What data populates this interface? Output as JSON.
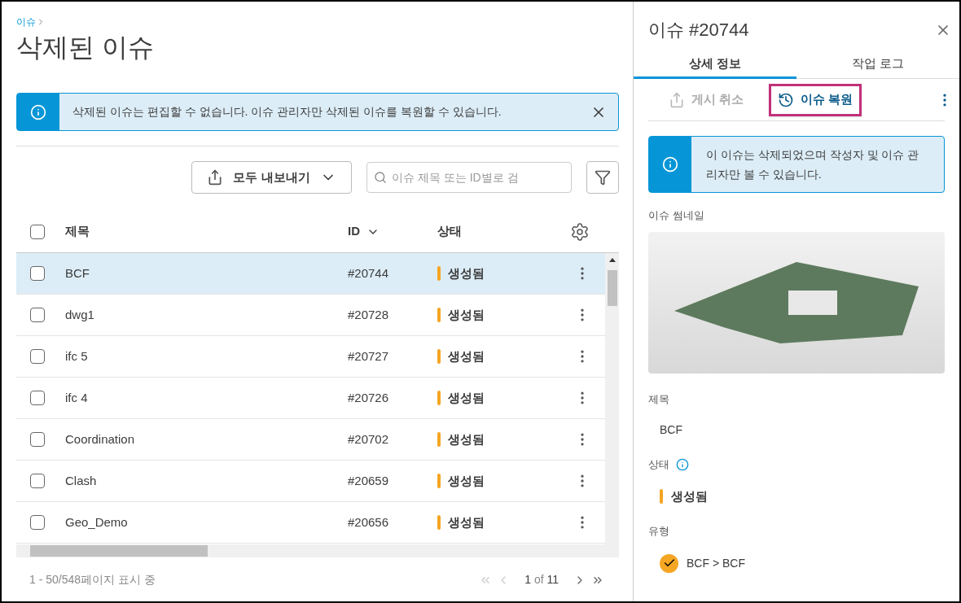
{
  "breadcrumb": "이슈",
  "page_title": "삭제된 이슈",
  "banner": {
    "message": "삭제된 이슈는 편집할 수 없습니다. 이슈 관리자만 삭제된 이슈를 복원할 수 있습니다."
  },
  "toolbar": {
    "export_label": "모두 내보내기",
    "search": {
      "placeholder": "이슈 제목 또는 ID별로 검"
    }
  },
  "table": {
    "columns": [
      {
        "label": "제목",
        "sorted": false
      },
      {
        "label": "ID",
        "sorted": true
      },
      {
        "label": "상태",
        "sorted": false
      }
    ],
    "header_checked": false,
    "rows": [
      {
        "title": "BCF",
        "id": "#20744",
        "status": "생성됨",
        "color": "#f5a623",
        "selected": true,
        "checked": false
      },
      {
        "title": "dwg1",
        "id": "#20728",
        "status": "생성됨",
        "color": "#f5a623",
        "selected": false,
        "checked": false
      },
      {
        "title": "ifc 5",
        "id": "#20727",
        "status": "생성됨",
        "color": "#f5a623",
        "selected": false,
        "checked": false
      },
      {
        "title": "ifc 4",
        "id": "#20726",
        "status": "생성됨",
        "color": "#f5a623",
        "selected": false,
        "checked": false
      },
      {
        "title": "Coordination",
        "id": "#20702",
        "status": "생성됨",
        "color": "#f5a623",
        "selected": false,
        "checked": false
      },
      {
        "title": "Clash",
        "id": "#20659",
        "status": "생성됨",
        "color": "#f5a623",
        "selected": false,
        "checked": false
      },
      {
        "title": "Geo_Demo",
        "id": "#20656",
        "status": "생성됨",
        "color": "#f5a623",
        "selected": false,
        "checked": false
      }
    ]
  },
  "footer": {
    "summary": "1 - 50/548페이지 표시 중",
    "page": "1",
    "of": "of",
    "total": "11"
  },
  "panel": {
    "title": "이슈 #20744",
    "tabs": [
      {
        "label": "상세 정보",
        "selected": true
      },
      {
        "label": "작업 로그",
        "selected": false
      }
    ],
    "actions": [
      {
        "kind": "unpublish",
        "label": "게시 취소",
        "disabled": true,
        "highlighted": false
      },
      {
        "kind": "restore",
        "label": "이슈 복원",
        "disabled": false,
        "highlighted": true
      }
    ],
    "notice": "이 이슈는 삭제되었으며 작성자 및 이슈 관리자만 볼 수 있습니다.",
    "thumbnail_label": "이슈 썸네일",
    "fields": [
      {
        "kind": "text",
        "label": "제목",
        "value": "BCF"
      },
      {
        "kind": "status",
        "label": "상태",
        "value": "생성됨",
        "color": "#f5a623"
      },
      {
        "kind": "type",
        "label": "유형",
        "value": "BCF > BCF",
        "color": "#f5a623"
      }
    ]
  }
}
